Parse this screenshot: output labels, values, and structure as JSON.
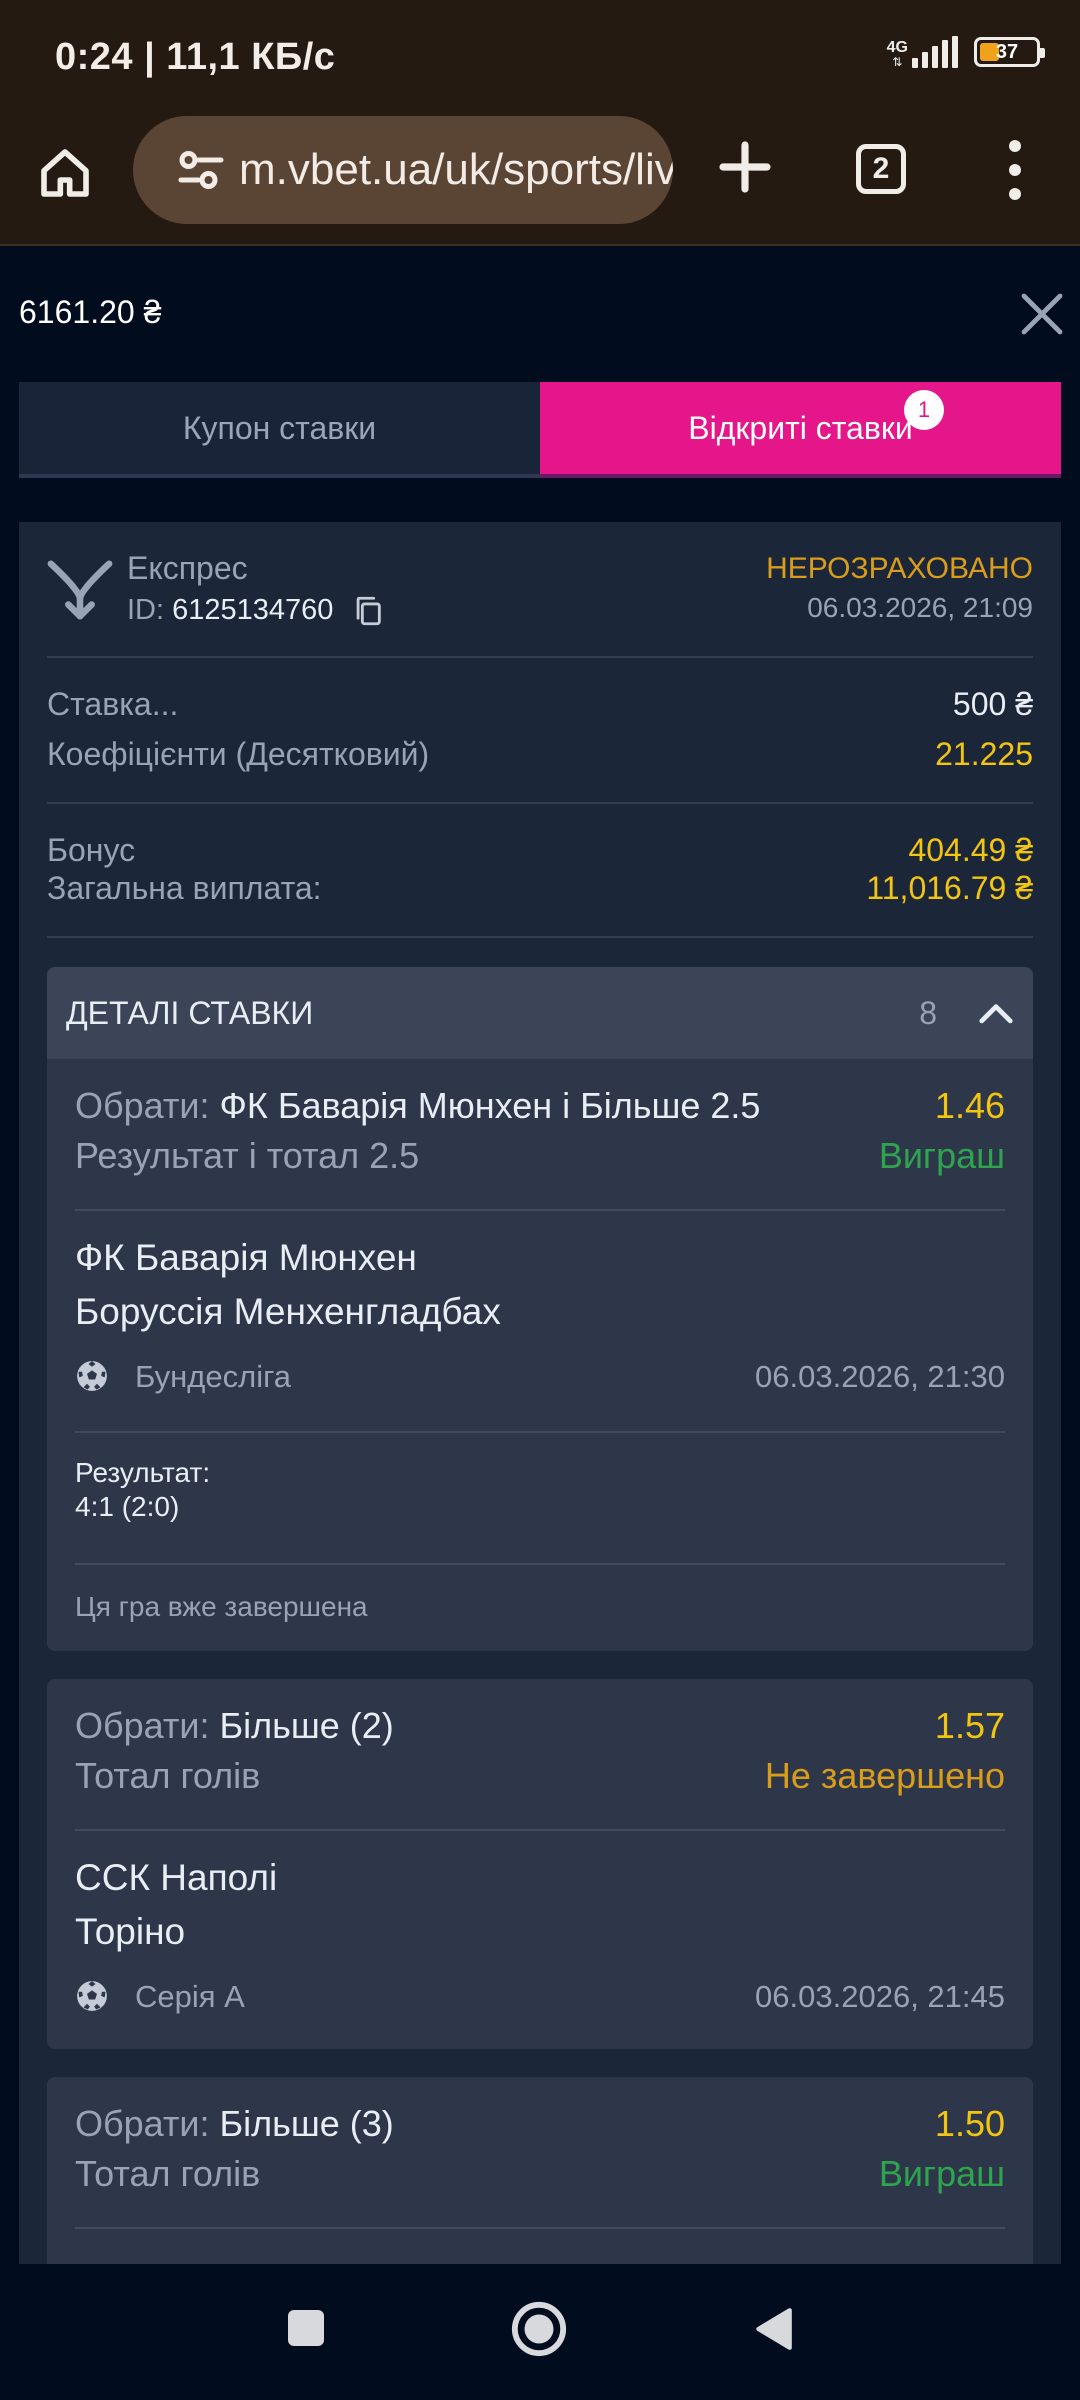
{
  "status_bar": {
    "time_speed": "0:24 | 11,1 КБ/с",
    "network": "4G",
    "battery": "37",
    "battery_level": 0.37
  },
  "browser": {
    "url": "m.vbet.ua/uk/sports/live",
    "tab_count": "2"
  },
  "header": {
    "balance": "6161.20 ₴"
  },
  "tabs": {
    "coupon": "Купон ставки",
    "open": "Відкриті ставки",
    "open_badge": "1"
  },
  "bet": {
    "type": "Експрес",
    "id_label": "ID:",
    "id_value": "6125134760",
    "status": "НЕРОЗРАХОВАНО",
    "datetime": "06.03.2026, 21:09",
    "stake_label": "Ставка...",
    "stake_value": "500 ₴",
    "odds_label": "Коефіцієнти (Десятковий)",
    "odds_value": "21.225",
    "bonus_label": "Бонус",
    "bonus_value": "404.49 ₴",
    "payout_label": "Загальна виплата:",
    "payout_value": "11,016.79 ₴"
  },
  "details": {
    "title": "ДЕТАЛІ СТАВКИ",
    "count": "8",
    "events": [
      {
        "select_label": "Обрати:",
        "selection": "ФК Баварія Мюнхен і Більше 2.5",
        "market": "Результат і тотал 2.5",
        "odds": "1.46",
        "outcome": "Виграш",
        "team1": "ФК Баварія Мюнхен",
        "team2": "Боруссія Менхенгладбах",
        "league": "Бундесліга",
        "datetime": "06.03.2026, 21:30",
        "result_label": "Результат:",
        "result_value": "4:1 (2:0)",
        "note": "Ця гра вже завершена"
      },
      {
        "select_label": "Обрати:",
        "selection": "Більше (2)",
        "market": "Тотал голів",
        "odds": "1.57",
        "outcome": "Не завершено",
        "team1": "ССК Наполі",
        "team2": "Торіно",
        "league": "Серія А",
        "datetime": "06.03.2026, 21:45"
      },
      {
        "select_label": "Обрати:",
        "selection": "Більше (3)",
        "market": "Тотал голів",
        "odds": "1.50",
        "outcome": "Виграш"
      }
    ]
  },
  "colors": {
    "accent": "#e5158a",
    "odds": "#f2c511",
    "win": "#2ea44f",
    "pending": "#d99d1b"
  },
  "icons": [
    "home-icon",
    "tune-icon",
    "plus-icon",
    "tabs-icon",
    "more-vert-icon",
    "close-icon",
    "express-icon",
    "copy-icon",
    "chevron-up-icon",
    "soccer-ball-icon",
    "square-nav-icon",
    "circle-nav-icon",
    "back-nav-icon"
  ]
}
